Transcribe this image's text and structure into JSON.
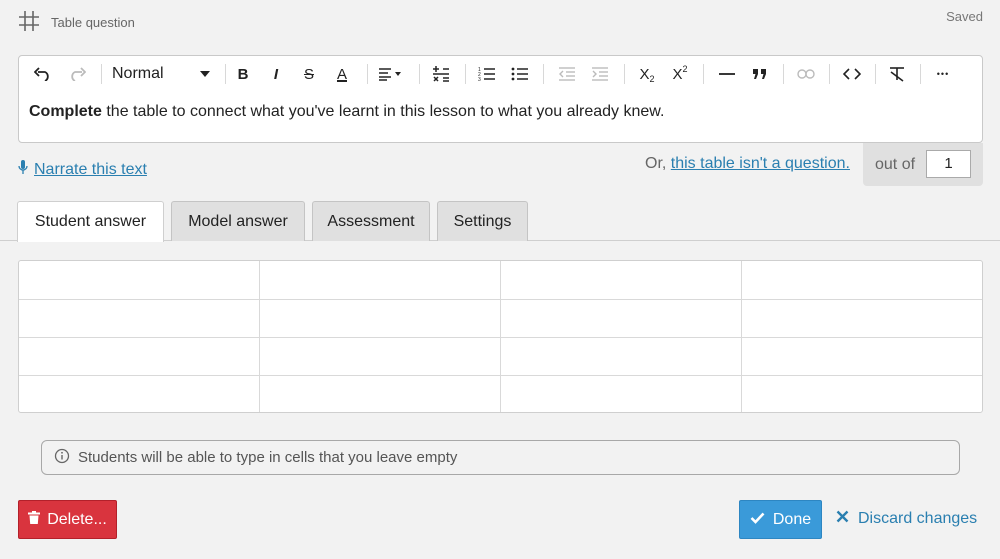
{
  "header": {
    "icon": "table-grid-icon",
    "title": "Table question",
    "status": "Saved"
  },
  "toolbar": {
    "undo_icon": "undo-icon",
    "redo_icon": "redo-icon",
    "format_value": "Normal",
    "bold_glyph": "B",
    "italic_glyph": "I",
    "strike_glyph": "S",
    "textcolor_glyph": "A",
    "subscript_base": "X",
    "subscript_mark": "2",
    "superscript_base": "X",
    "superscript_mark": "2",
    "more_glyph": "•••"
  },
  "editor": {
    "bold_text": "Complete",
    "body_text": " the table to connect what you've learnt in this lesson to what you already knew."
  },
  "narrate": {
    "label": "Narrate this text",
    "icon": "microphone-icon"
  },
  "not_question": {
    "prefix": "Or, ",
    "link": "this table isn't a question."
  },
  "score": {
    "label": "out of",
    "value": "1"
  },
  "tabs": [
    {
      "label": "Student answer",
      "active": true
    },
    {
      "label": "Model answer",
      "active": false
    },
    {
      "label": "Assessment",
      "active": false
    },
    {
      "label": "Settings",
      "active": false
    }
  ],
  "table": {
    "rows": 4,
    "cols": 4
  },
  "info": {
    "icon": "info-icon",
    "text": "Students will be able to type in cells that you leave empty"
  },
  "actions": {
    "delete_label": "Delete...",
    "delete_icon": "trash-icon",
    "done_label": "Done",
    "done_icon": "check-icon",
    "discard_label": "Discard changes",
    "discard_icon": "close-icon"
  },
  "colors": {
    "accent_link": "#2a7fb0",
    "done": "#3a9ad9",
    "delete": "#d9343e",
    "background": "#f2f2f2"
  }
}
